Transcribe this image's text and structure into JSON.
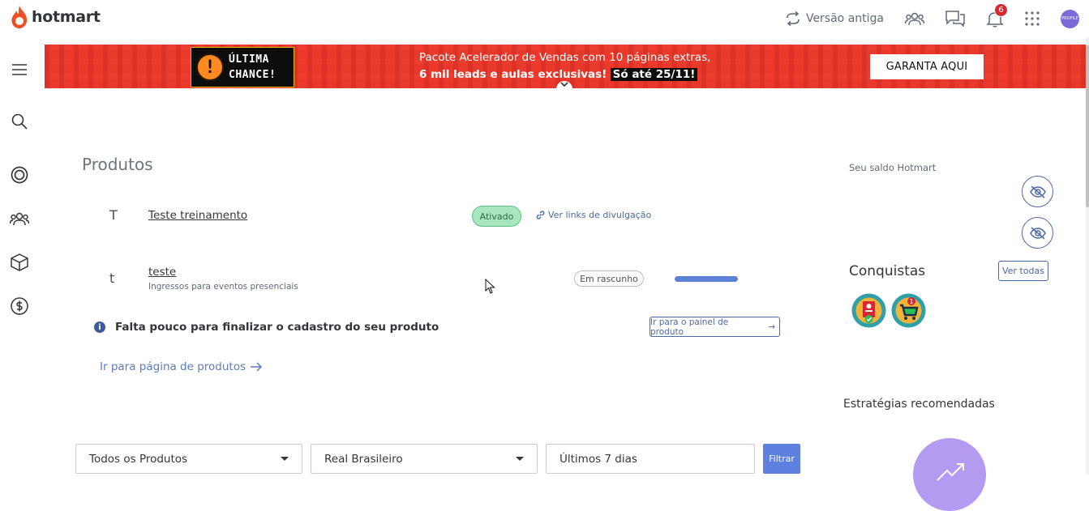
{
  "header": {
    "logo_text": "hotmart",
    "old_version_label": "Versão antiga",
    "notification_count": "6",
    "avatar_text": "PROFILE"
  },
  "banner": {
    "badge_line1": "ÚLTIMA",
    "badge_line2": "CHANCE!",
    "badge_icon": "!",
    "text_line1": "Pacote Acelerador de Vendas com 10 páginas extras,",
    "text_line2": "6 mil leads e aulas exclusivas!",
    "highlight": "Só até 25/11!",
    "cta_label": "GARANTA AQUI",
    "close_glyph": "⌄"
  },
  "products": {
    "title": "Produtos",
    "items": [
      {
        "initial": "T",
        "name": "Teste treinamento",
        "subtitle": "",
        "status": "Ativado",
        "link_label": "Ver links de divulgação"
      },
      {
        "initial": "t",
        "name": "teste",
        "subtitle": "Ingressos para eventos presenciais",
        "status": "Em rascunho",
        "progress": 1.0
      }
    ],
    "info_text": "Falta pouco para finalizar o cadastro do seu produto",
    "panel_button_label": "Ir para o painel de produto",
    "go_products_label": "Ir para página de produtos",
    "arrow_glyph": "→"
  },
  "sidebar_right": {
    "balance_label": "Seu saldo Hotmart",
    "achievements_title": "Conquistas",
    "see_all_label": "Ver todas",
    "strategies_title": "Estratégias recomendadas"
  },
  "filters": {
    "product_select": "Todos os Produtos",
    "currency_select": "Real Brasileiro",
    "period_field": "Últimos 7 dias",
    "filter_button": "Filtrar"
  },
  "colors": {
    "brand": "#e8392b",
    "accent": "#4b6aa8",
    "active_badge": "#a8e6bd",
    "progress": "#5e81d8"
  }
}
